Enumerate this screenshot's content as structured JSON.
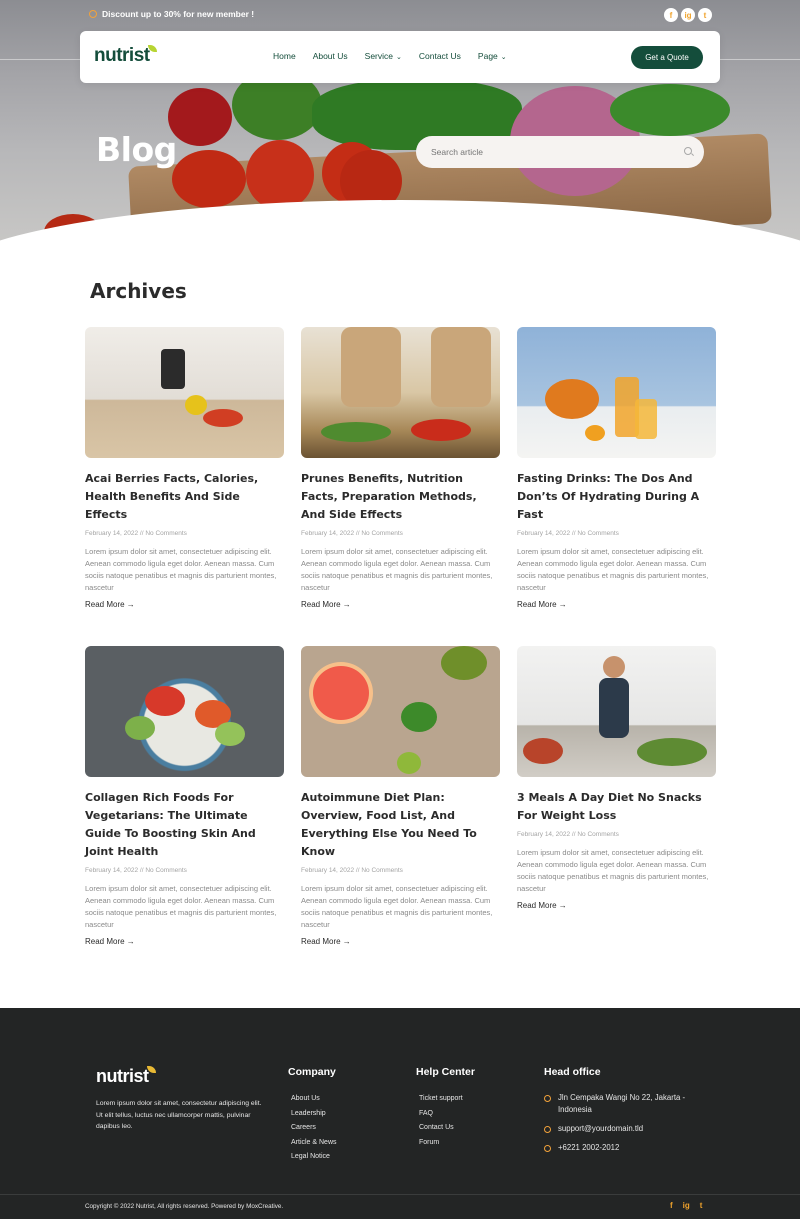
{
  "topbar": {
    "promo": "Discount up to 30% for new member !",
    "social": [
      "f",
      "ig",
      "t"
    ]
  },
  "nav": {
    "logo": "nutrist",
    "items": [
      {
        "label": "Home",
        "chevron": ""
      },
      {
        "label": "About Us",
        "chevron": ""
      },
      {
        "label": "Service",
        "chevron": "⌄"
      },
      {
        "label": "Contact Us",
        "chevron": ""
      },
      {
        "label": "Page",
        "chevron": "⌄"
      }
    ],
    "cta": "Get a Quote"
  },
  "hero": {
    "title": "Blog",
    "search_placeholder": "Search article"
  },
  "archives": {
    "title": "Archives",
    "read_more": "Read More →",
    "posts": [
      {
        "title": "Acai Berries Facts, Calories, Health Benefits And Side Effects",
        "date": "February 14, 2022",
        "comments": "No Comments",
        "excerpt": "Lorem ipsum dolor sit amet, consectetuer adipiscing elit. Aenean commodo ligula eget dolor. Aenean massa. Cum sociis natoque penatibus et magnis dis parturient montes, nascetur"
      },
      {
        "title": "Prunes Benefits, Nutrition Facts, Preparation Methods, And Side Effects",
        "date": "February 14, 2022",
        "comments": "No Comments",
        "excerpt": "Lorem ipsum dolor sit amet, consectetuer adipiscing elit. Aenean commodo ligula eget dolor. Aenean massa. Cum sociis natoque penatibus et magnis dis parturient montes, nascetur"
      },
      {
        "title": "Fasting Drinks: The Dos And Don’ts Of Hydrating During A Fast",
        "date": "February 14, 2022",
        "comments": "No Comments",
        "excerpt": "Lorem ipsum dolor sit amet, consectetuer adipiscing elit. Aenean commodo ligula eget dolor. Aenean massa. Cum sociis natoque penatibus et magnis dis parturient montes, nascetur"
      },
      {
        "title": "Collagen Rich Foods For Vegetarians: The Ultimate Guide To Boosting Skin And Joint Health",
        "date": "February 14, 2022",
        "comments": "No Comments",
        "excerpt": "Lorem ipsum dolor sit amet, consectetuer adipiscing elit. Aenean commodo ligula eget dolor. Aenean massa. Cum sociis natoque penatibus et magnis dis parturient montes, nascetur"
      },
      {
        "title": "Autoimmune Diet Plan: Overview, Food List, And Everything Else You Need To Know",
        "date": "February 14, 2022",
        "comments": "No Comments",
        "excerpt": "Lorem ipsum dolor sit amet, consectetuer adipiscing elit. Aenean commodo ligula eget dolor. Aenean massa. Cum sociis natoque penatibus et magnis dis parturient montes, nascetur"
      },
      {
        "title": "3 Meals A Day Diet No Snacks For Weight Loss",
        "date": "February 14, 2022",
        "comments": "No Comments",
        "excerpt": "Lorem ipsum dolor sit amet, consectetuer adipiscing elit. Aenean commodo ligula eget dolor. Aenean massa. Cum sociis natoque penatibus et magnis dis parturient montes, nascetur"
      }
    ]
  },
  "footer": {
    "logo": "nutrist",
    "about": "Lorem ipsum dolor sit amet, consectetur adipiscing elit. Ut elit tellus, luctus nec ullamcorper mattis, pulvinar dapibus leo.",
    "company": {
      "title": "Company",
      "links": [
        "About Us",
        "Leadership",
        "Careers",
        "Article & News",
        "Legal Notice"
      ]
    },
    "help": {
      "title": "Help Center",
      "links": [
        "Ticket support",
        "FAQ",
        "Contact Us",
        "Forum"
      ]
    },
    "office": {
      "title": "Head office",
      "address": "Jln Cempaka Wangi No 22, Jakarta - Indonesia",
      "email": "support@yourdomain.tld",
      "phone": "+6221 2002-2012"
    },
    "copyright": "Copyright © 2022 Nutrist, All rights reserved. Powered by MoxCreative.",
    "social": [
      "f",
      "ig",
      "t"
    ]
  },
  "colors": {
    "brand": "#144d3b",
    "accent": "#f0a32c",
    "footer_bg": "#232525"
  }
}
